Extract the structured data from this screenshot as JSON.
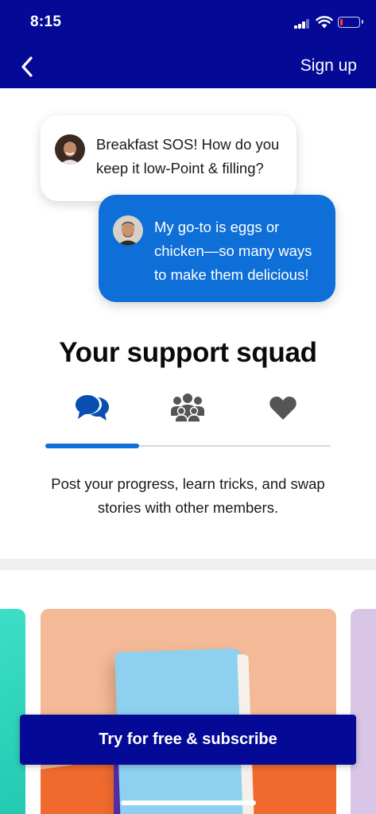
{
  "status_bar": {
    "time": "8:15"
  },
  "nav": {
    "signup_label": "Sign up"
  },
  "chat": {
    "message_1": {
      "text": "Breakfast SOS! How do you keep it low-Point & filling?"
    },
    "message_2": {
      "text": "My go-to is eggs or chicken—so many ways to make them delicious!"
    }
  },
  "support": {
    "title": "Your support squad",
    "tabs": [
      {
        "icon": "chat-bubbles-icon",
        "active": true
      },
      {
        "icon": "group-icon",
        "active": false
      },
      {
        "icon": "heart-icon",
        "active": false
      }
    ],
    "progress_fraction": 0.33,
    "description": "Post your progress, learn tricks, and swap stories with other members."
  },
  "cta": {
    "label": "Try for free & subscribe"
  },
  "colors": {
    "brand_navy": "#050a96",
    "accent_blue": "#0e6fd8",
    "icon_gray": "#555555"
  }
}
